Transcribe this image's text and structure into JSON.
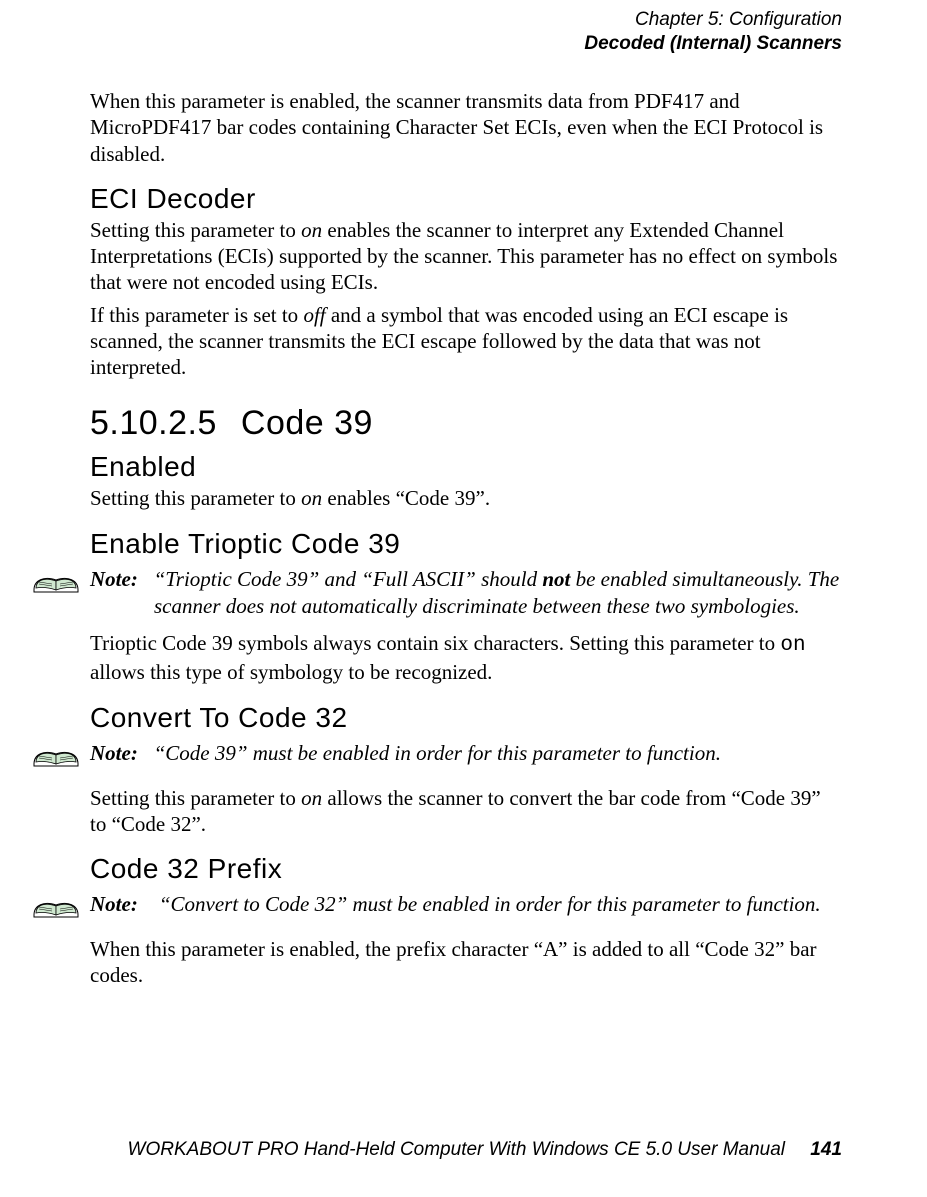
{
  "header": {
    "chapter": "Chapter 5: Configuration",
    "section": "Decoded (Internal) Scanners"
  },
  "intro_para": "When this parameter is enabled, the scanner transmits data from PDF417 and MicroPDF417 bar codes containing Character Set ECIs, even when the ECI Protocol is disabled.",
  "eci_decoder": {
    "heading": "ECI Decoder",
    "p1_a": "Setting this parameter to ",
    "p1_on": "on",
    "p1_b": " enables the scanner to interpret any Extended Channel Interpretations (ECIs) supported by the scanner. This parameter has no effect on symbols that were not encoded using ECIs.",
    "p2_a": "If this parameter is set to ",
    "p2_off": "off",
    "p2_b": " and a symbol that was encoded using an ECI escape is scanned, the scanner transmits the ECI escape followed by the data that was not interpreted."
  },
  "code39": {
    "num": "5.10.2.5",
    "title": "Code 39",
    "enabled_heading": "Enabled",
    "enabled_p_a": "Setting this parameter to ",
    "enabled_on": "on",
    "enabled_p_b": " enables “Code 39”.",
    "trioptic_heading": "Enable Trioptic Code 39",
    "trioptic_note_label": "Note:",
    "trioptic_note_a": "“Trioptic Code 39” and “Full ASCII” should ",
    "trioptic_note_not": "not",
    "trioptic_note_b": " be enabled simultaneously. The scanner does not automatically discriminate between these two symbologies.",
    "trioptic_p_a": "Trioptic Code 39 symbols always contain six characters. Setting this parameter to ",
    "trioptic_on": "on",
    "trioptic_p_b": " allows this type of symbology to be recognized.",
    "convert32_heading": "Convert To Code 32",
    "convert32_note_label": "Note:",
    "convert32_note": "“Code 39” must be enabled in order for this parameter to function.",
    "convert32_p_a": "Setting this parameter to ",
    "convert32_on": "on",
    "convert32_p_b": " allows the scanner to convert the bar code from “Code 39” to “Code 32”.",
    "prefix_heading": "Code 32 Prefix",
    "prefix_note_label": "Note:",
    "prefix_note": " “Convert to Code 32” must be enabled in order for this parameter to function.",
    "prefix_p": "When this parameter is enabled, the prefix character “A” is added to all “Code 32” bar codes."
  },
  "footer": {
    "title": "WORKABOUT PRO Hand-Held Computer With Windows CE 5.0 User Manual",
    "page": "141"
  }
}
